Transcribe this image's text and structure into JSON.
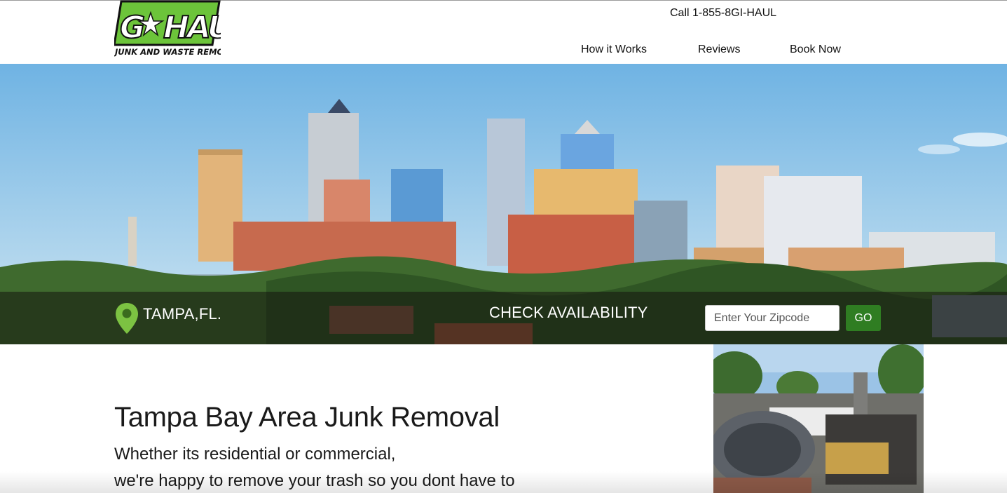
{
  "header": {
    "logo_text": "G.I.HAUL",
    "logo_tagline": "JUNK AND WASTE REMOVAL",
    "phone": "Call 1-855-8GI-HAUL",
    "nav": [
      {
        "label": "How it Works"
      },
      {
        "label": "Reviews"
      },
      {
        "label": "Book Now"
      }
    ]
  },
  "hero": {
    "location": "TAMPA,FL.",
    "check_label": "CHECK AVAILABILITY",
    "zip_placeholder": "Enter Your Zipcode",
    "go_label": "GO"
  },
  "content": {
    "title": "Tampa Bay Area Junk Removal",
    "line1": "Whether its residential or commercial,",
    "line2": "we're happy to remove your trash so you dont have to"
  },
  "colors": {
    "brand_green": "#6cc43a",
    "button_green": "#2f7d22",
    "pin_green": "#7cc242"
  },
  "icons": [
    "location-pin-icon",
    "star-icon"
  ]
}
